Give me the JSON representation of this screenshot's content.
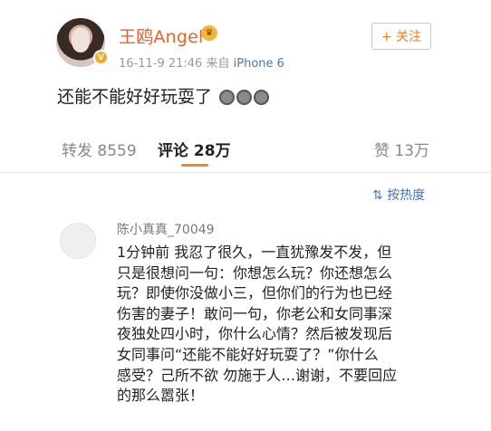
{
  "post": {
    "username": "王鸥Angel",
    "verified_badge": "V",
    "crown_icon": "crown-emoji-icon",
    "time": "16-11-9 21:46",
    "source_prefix": "来自",
    "device": "iPhone 6",
    "follow_label": "+ 关注",
    "text": "还能不能好好玩耍了",
    "emojis": [
      "crying-emoji-icon",
      "crying-emoji-icon",
      "crying-emoji-icon"
    ]
  },
  "stats": {
    "reposts": "转发 8559",
    "comments": "评论 28万",
    "likes": "赞 13万"
  },
  "sort_label": "按热度",
  "comment": {
    "username": "陈小真真_70049",
    "lines": [
      "1分钟前 我忍了很久，一直犹豫发不发，但",
      "只是很想问一句：你想怎么玩？你还想怎么",
      "玩？即使你没做小三，但你们的行为也已经",
      "伤害的妻子！敢问一句，你老公和女同事深",
      "夜独处四小时，你什么心情？然后被发现后",
      "女同事问“还能不能好好玩耍了？”你什么",
      "感受？己所不欲 勿施于人…谢谢，不要回应",
      "的那么嚣张！"
    ]
  },
  "colors": {
    "accent": "#f3842a",
    "username": "#e8602b",
    "link": "#4a76b5"
  }
}
